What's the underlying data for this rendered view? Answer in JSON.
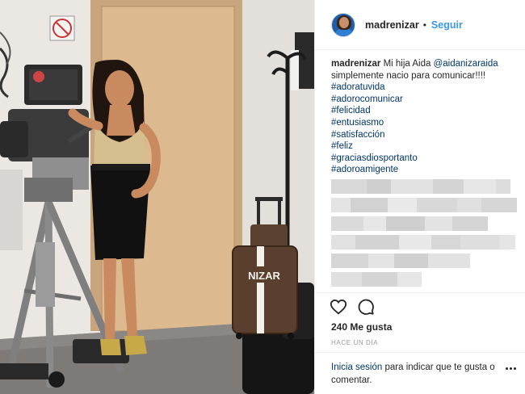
{
  "post": {
    "username": "madrenizar",
    "follow_label": "Seguir",
    "separator": "•",
    "caption": {
      "username": "madrenizar",
      "text_before_mention": "Mi hija Aida",
      "mention": "@aidanizaraida",
      "text_after_mention": "simplemente nacio para comunicar!!!!",
      "hashtags": [
        "#adoratuvida",
        "#adorocomunicar",
        "#felicidad",
        "#entusiasmo",
        "#satisfacción",
        "#feliz",
        "#graciasdiosportanto",
        "#adoroamigente"
      ]
    },
    "likes": "240 Me gusta",
    "timestamp": "HACE UN DÍA",
    "login_link": "Inicia sesión",
    "login_text": "para indicar que te gusta o comentar."
  },
  "photo": {
    "luggage_text": "NIZAR"
  },
  "icons": {
    "like": "heart-icon",
    "comment": "comment-icon",
    "more": "more-options-icon"
  },
  "colors": {
    "accent": "#3897f0",
    "link": "#003569",
    "text": "#262626",
    "muted": "#999999"
  }
}
